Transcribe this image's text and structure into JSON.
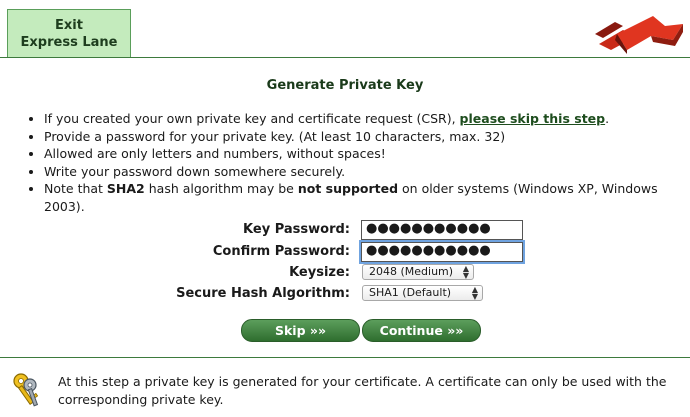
{
  "header": {
    "exit_line1": "Exit",
    "exit_line2": "Express Lane"
  },
  "title": "Generate Private Key",
  "bullets": {
    "b1_prefix": "If you created your own private key and certificate request (CSR), ",
    "b1_link": "please skip this step",
    "b1_suffix": ".",
    "b2": "Provide a password for your private key. (At least 10 characters, max. 32)",
    "b3": "Allowed are only letters and numbers, without spaces!",
    "b4": "Write your password down somewhere securely.",
    "b5_a": "Note that ",
    "b5_b": "SHA2",
    "b5_c": " hash algorithm may be ",
    "b5_d": "not supported",
    "b5_e": " on older systems (Windows XP, Windows 2003)."
  },
  "form": {
    "key_password_label": "Key Password:",
    "key_password_value": "●●●●●●●●●●●",
    "confirm_password_label": "Confirm Password:",
    "confirm_password_value": "●●●●●●●●●●●",
    "keysize_label": "Keysize:",
    "keysize_value": "2048 (Medium)",
    "hash_label": "Secure Hash Algorithm:",
    "hash_value": "SHA1 (Default)"
  },
  "buttons": {
    "skip": "Skip »»",
    "continue": "Continue »»"
  },
  "footer": {
    "text": "At this step a private key is generated for your certificate. A certificate can only be used with the corresponding private key.",
    "icon": "keys-icon"
  },
  "colors": {
    "accent_green": "#2f6e2f",
    "exit_bg": "#c4ebbd",
    "logo_red": "#d42a1a"
  }
}
